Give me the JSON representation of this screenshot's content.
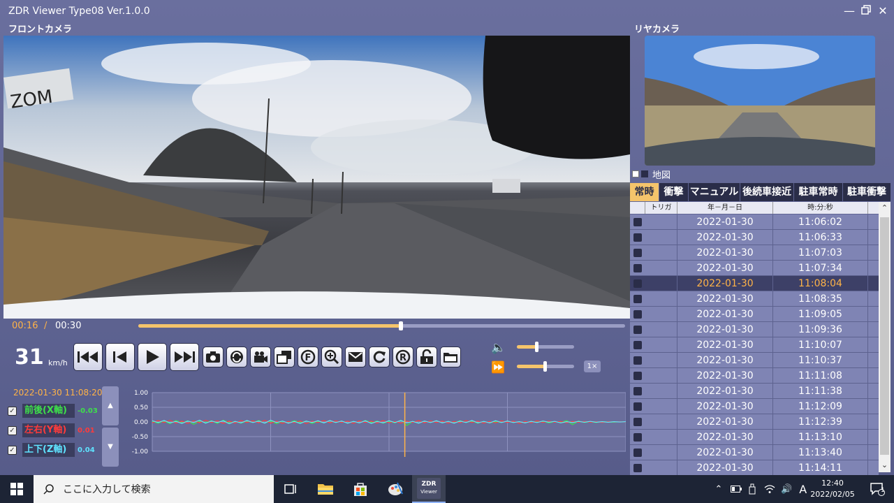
{
  "window": {
    "title": "ZDR Viewer Type08 Ver.1.0.0",
    "minimize_icon": "minimize-icon",
    "maximize_icon": "restore-icon",
    "close_icon": "close-icon"
  },
  "front_camera": {
    "label": "フロントカメラ"
  },
  "rear_camera": {
    "label": "リヤカメラ"
  },
  "playback": {
    "current_time": "00:16",
    "separator": "/",
    "total_time": "00:30",
    "progress": 0.54,
    "speed_value": "31",
    "speed_unit": "km/h",
    "volume": 0.35,
    "rate": 0.5,
    "rate_label": "1×"
  },
  "controls": [
    {
      "name": "skip-previous-button",
      "icon": "skip-previous-icon"
    },
    {
      "name": "step-back-button",
      "icon": "step-back-icon"
    },
    {
      "name": "play-button",
      "icon": "play-icon"
    },
    {
      "name": "skip-next-button",
      "icon": "skip-next-icon"
    },
    {
      "name": "snapshot-button",
      "icon": "camera-icon"
    },
    {
      "name": "rotate-button",
      "icon": "rotate-icon"
    },
    {
      "name": "video-button",
      "icon": "video-icon"
    },
    {
      "name": "window-button",
      "icon": "window-icon"
    },
    {
      "name": "front-button",
      "icon": "f-circle-icon"
    },
    {
      "name": "zoom-button",
      "icon": "zoom-icon"
    },
    {
      "name": "envelope-button",
      "icon": "envelope-icon"
    },
    {
      "name": "reload-button",
      "icon": "reload-icon"
    },
    {
      "name": "rear-button",
      "icon": "r-circle-icon"
    },
    {
      "name": "unlock-button",
      "icon": "unlock-icon"
    },
    {
      "name": "folder-button",
      "icon": "folder-icon"
    }
  ],
  "gsensor": {
    "timestamp": "2022-01-30 11:08:20",
    "axes": [
      {
        "label": "前後(X軸)",
        "value": "-0.03",
        "color": "#3ee04a",
        "checked": "✓"
      },
      {
        "label": "左右(Y軸)",
        "value": "0.01",
        "color": "#ff3b3b",
        "checked": "✓"
      },
      {
        "label": "上下(Z軸)",
        "value": "0.04",
        "color": "#5fe3ff",
        "checked": "✓"
      }
    ],
    "scroll_up_icon": "triangle-up-icon",
    "scroll_down_icon": "triangle-down-icon"
  },
  "chart_data": {
    "type": "line",
    "y_ticks": [
      "1.00",
      "0.50",
      "0.00",
      "-0.50",
      "-1.00"
    ],
    "ylim": [
      -1,
      1
    ],
    "xlim": [
      0,
      30
    ],
    "grid": true,
    "cursor_x": 16,
    "series": [
      {
        "color": "#3ee04a",
        "values": [
          0.02,
          -0.04,
          0.03,
          -0.06,
          0.05,
          -0.03,
          0.04,
          -0.08,
          0.03,
          -0.02,
          0.04,
          -0.05,
          0.06,
          -0.03,
          0.02,
          -0.04,
          0.03,
          -0.02,
          0.05,
          -0.04,
          0.03,
          -0.06,
          0.02,
          -0.03,
          0.04,
          -0.02,
          0.03,
          -0.05,
          0.02,
          -0.03,
          0.04,
          -0.02,
          0.03,
          -0.04,
          0.02,
          -0.03,
          0.05,
          -0.02,
          0.03,
          -0.04,
          0.02,
          -0.03,
          0.06,
          -0.12,
          0.02,
          -0.04,
          0.03,
          -0.02,
          0.04,
          -0.03,
          0.02,
          -0.03,
          0.04,
          -0.02,
          0.03,
          -0.04,
          0.02,
          -0.03,
          0.01,
          -0.02,
          0.03,
          -0.02,
          0.01,
          -0.03,
          0.02,
          -0.01,
          0.02,
          -0.03,
          0.01,
          -0.02,
          0.05,
          -0.09,
          0.03,
          -0.02,
          0.01,
          -0.02,
          0.01,
          0.0,
          -0.01,
          0.01,
          0.0
        ]
      },
      {
        "color": "#ff3b3b",
        "values": [
          -0.03,
          0.05,
          -0.02,
          0.06,
          -0.04,
          0.03,
          -0.05,
          0.04,
          -0.03,
          0.06,
          -0.02,
          0.04,
          -0.05,
          0.03,
          -0.04,
          0.05,
          -0.02,
          0.04,
          -0.03,
          0.06,
          -0.04,
          0.03,
          -0.05,
          0.02,
          -0.03,
          0.04,
          -0.06,
          0.03,
          -0.02,
          0.05,
          -0.03,
          0.04,
          -0.02,
          0.03,
          -0.05,
          0.04,
          -0.02,
          0.03,
          -0.04,
          0.05,
          -0.03,
          0.02,
          -0.04,
          0.03,
          -0.02,
          0.05,
          -0.03,
          0.04,
          -0.02,
          0.03,
          -0.04,
          0.02,
          -0.03,
          0.05,
          -0.02,
          0.03,
          -0.04,
          0.02,
          -0.03,
          0.04,
          -0.02,
          0.03,
          -0.05,
          0.02,
          -0.03,
          0.04,
          -0.02,
          0.03,
          -0.01,
          0.02,
          -0.03,
          0.02,
          -0.01,
          0.02,
          -0.01,
          0.01,
          -0.02,
          0.01,
          0.0,
          0.01,
          0.0
        ]
      },
      {
        "color": "#5fe3ff",
        "values": [
          0.04,
          -0.02,
          0.05,
          -0.03,
          0.02,
          -0.05,
          0.03,
          -0.02,
          0.06,
          -0.04,
          0.03,
          -0.02,
          0.04,
          -0.06,
          0.02,
          -0.03,
          0.05,
          -0.02,
          0.03,
          -0.04,
          0.06,
          -0.02,
          0.03,
          -0.04,
          0.02,
          -0.05,
          0.03,
          -0.02,
          0.04,
          -0.03,
          0.05,
          -0.02,
          0.03,
          -0.04,
          0.02,
          -0.03,
          0.04,
          -0.05,
          0.02,
          -0.03,
          0.04,
          -0.02,
          0.05,
          -0.03,
          0.02,
          -0.04,
          0.03,
          -0.02,
          0.04,
          -0.03,
          0.02,
          -0.04,
          0.03,
          -0.02,
          0.05,
          -0.03,
          0.02,
          -0.03,
          0.04,
          -0.02,
          0.03,
          -0.02,
          0.01,
          -0.03,
          0.02,
          -0.02,
          0.03,
          -0.01,
          0.02,
          -0.03,
          0.01,
          -0.02,
          0.02,
          -0.01,
          0.02,
          -0.01,
          0.01,
          -0.01,
          0.01,
          0.0,
          0.01
        ]
      }
    ]
  },
  "right_panel": {
    "map_label": "地図",
    "tabs": [
      {
        "label": "常時",
        "active": true
      },
      {
        "label": "衝撃",
        "active": false
      },
      {
        "label": "マニュアル",
        "active": false
      },
      {
        "label": "後続車接近",
        "active": false
      },
      {
        "label": "駐車常時",
        "active": false
      },
      {
        "label": "駐車衝撃",
        "active": false
      }
    ],
    "columns": [
      "",
      "トリガ",
      "年－月－日",
      "時:分:秒"
    ],
    "rows": [
      {
        "date": "2022-01-30",
        "time": "11:06:02"
      },
      {
        "date": "2022-01-30",
        "time": "11:06:33"
      },
      {
        "date": "2022-01-30",
        "time": "11:07:03"
      },
      {
        "date": "2022-01-30",
        "time": "11:07:34"
      },
      {
        "date": "2022-01-30",
        "time": "11:08:04",
        "selected": true
      },
      {
        "date": "2022-01-30",
        "time": "11:08:35"
      },
      {
        "date": "2022-01-30",
        "time": "11:09:05"
      },
      {
        "date": "2022-01-30",
        "time": "11:09:36"
      },
      {
        "date": "2022-01-30",
        "time": "11:10:07"
      },
      {
        "date": "2022-01-30",
        "time": "11:10:37"
      },
      {
        "date": "2022-01-30",
        "time": "11:11:08"
      },
      {
        "date": "2022-01-30",
        "time": "11:11:38"
      },
      {
        "date": "2022-01-30",
        "time": "11:12:09"
      },
      {
        "date": "2022-01-30",
        "time": "11:12:39"
      },
      {
        "date": "2022-01-30",
        "time": "11:13:10"
      },
      {
        "date": "2022-01-30",
        "time": "11:13:40"
      },
      {
        "date": "2022-01-30",
        "time": "11:14:11"
      }
    ]
  },
  "taskbar": {
    "search_placeholder": "ここに入力して検索",
    "ime": "A",
    "time": "12:40",
    "date": "2022/02/05",
    "notification_count": "1",
    "zdr_icon_text": "ZDR",
    "zdr_icon_sub": "Viewer"
  }
}
